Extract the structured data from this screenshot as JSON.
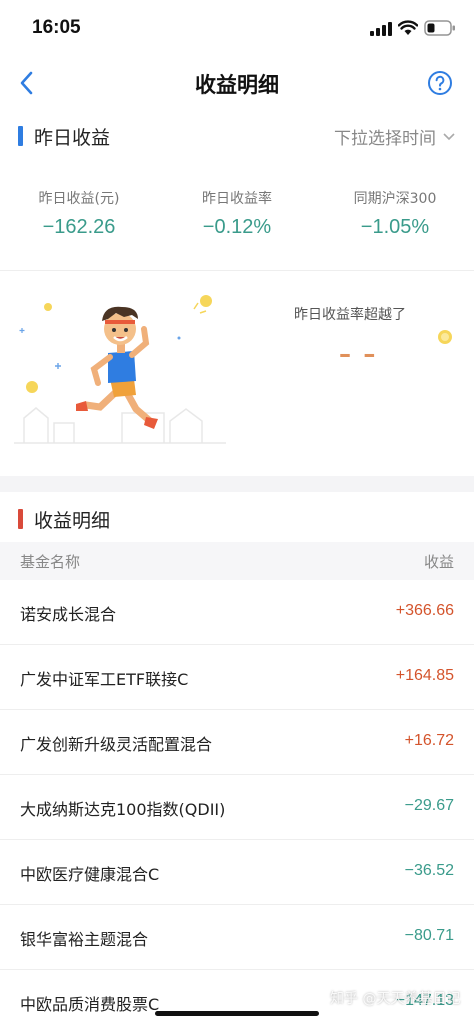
{
  "status_bar": {
    "time": "16:05"
  },
  "nav": {
    "title": "收益明细"
  },
  "yesterday": {
    "title": "昨日收益",
    "time_select": "下拉选择时间",
    "stats": [
      {
        "label": "昨日收益(元)",
        "value": "−162.26"
      },
      {
        "label": "昨日收益率",
        "value": "−0.12%"
      },
      {
        "label": "同期沪深300",
        "value": "−1.05%"
      }
    ],
    "beat_label": "昨日收益率超越了",
    "beat_value": "– –"
  },
  "detail": {
    "title": "收益明细",
    "col_name": "基金名称",
    "col_profit": "收益",
    "funds": [
      {
        "name": "诺安成长混合",
        "profit": "+366.66"
      },
      {
        "name": "广发中证军工ETF联接C",
        "profit": "+164.85"
      },
      {
        "name": "广发创新升级灵活配置混合",
        "profit": "+16.72"
      },
      {
        "name": "大成纳斯达克100指数(QDII)",
        "profit": "−29.67"
      },
      {
        "name": "中欧医疗健康混合C",
        "profit": "−36.52"
      },
      {
        "name": "银华富裕主题混合",
        "profit": "−80.71"
      },
      {
        "name": "中欧品质消费股票C",
        "profit": "−147.13"
      }
    ]
  },
  "watermark": "知乎 @天天养基日记",
  "colors": {
    "accent_blue": "#2f7de1",
    "section_bar_blue": "#2f7de1",
    "section_bar_red": "#d94a3a",
    "positive": "#d4542c",
    "negative": "#3a9b8b"
  }
}
